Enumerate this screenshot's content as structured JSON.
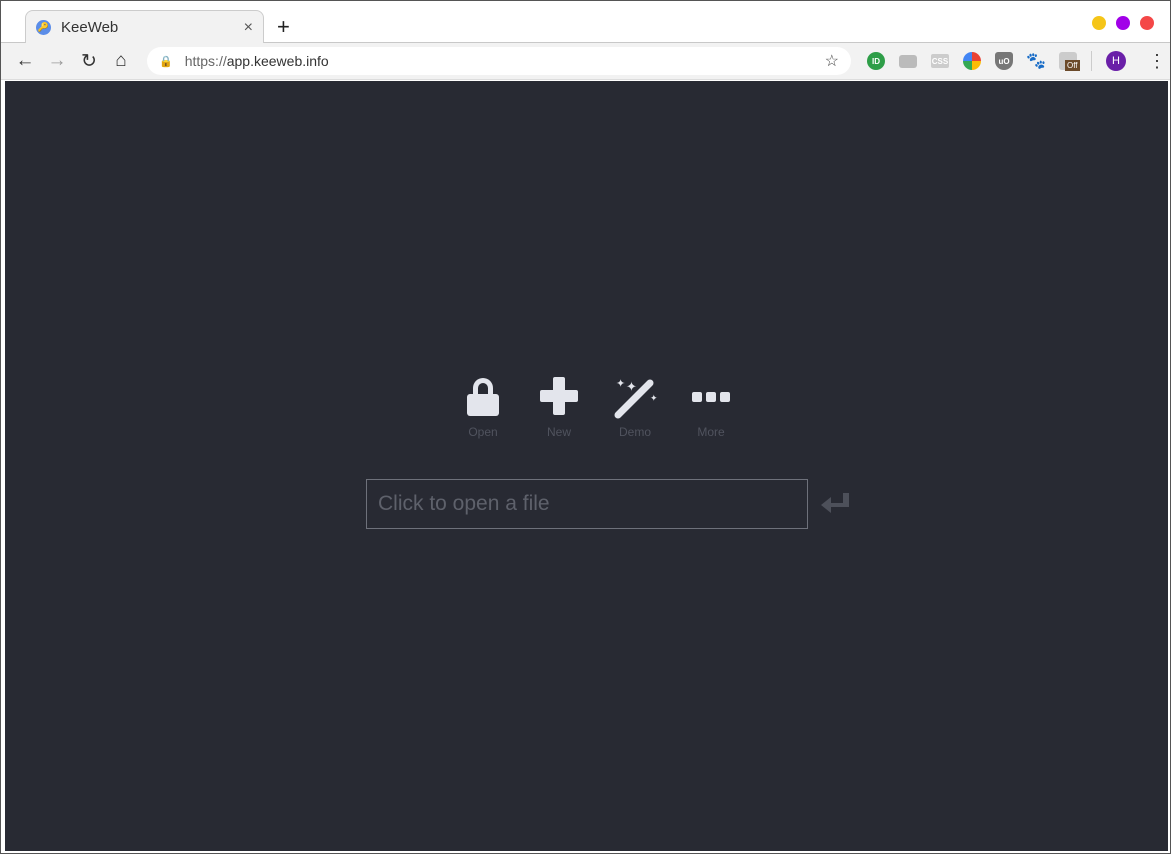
{
  "browser": {
    "tab": {
      "title": "KeeWeb",
      "favicon": "key-icon",
      "close": "×"
    },
    "new_tab": "+",
    "window_dots": [
      "#f5c518",
      "#a100e8",
      "#f44747"
    ],
    "url": {
      "scheme": "https://",
      "host": "app.keeweb.info"
    },
    "extensions": [
      "pushbullet",
      "keyboard",
      "css-viewer",
      "compass",
      "ublock",
      "gnome",
      "off-badge"
    ],
    "off_badge": "Off",
    "avatar": "H"
  },
  "app": {
    "background": "#282a33",
    "actions": [
      {
        "label": "Open",
        "icon": "lock-icon"
      },
      {
        "label": "New",
        "icon": "plus-icon"
      },
      {
        "label": "Demo",
        "icon": "magic-wand-icon"
      },
      {
        "label": "More",
        "icon": "ellipsis-icon"
      }
    ],
    "file_input": {
      "placeholder": "Click to open a file",
      "value": ""
    }
  }
}
